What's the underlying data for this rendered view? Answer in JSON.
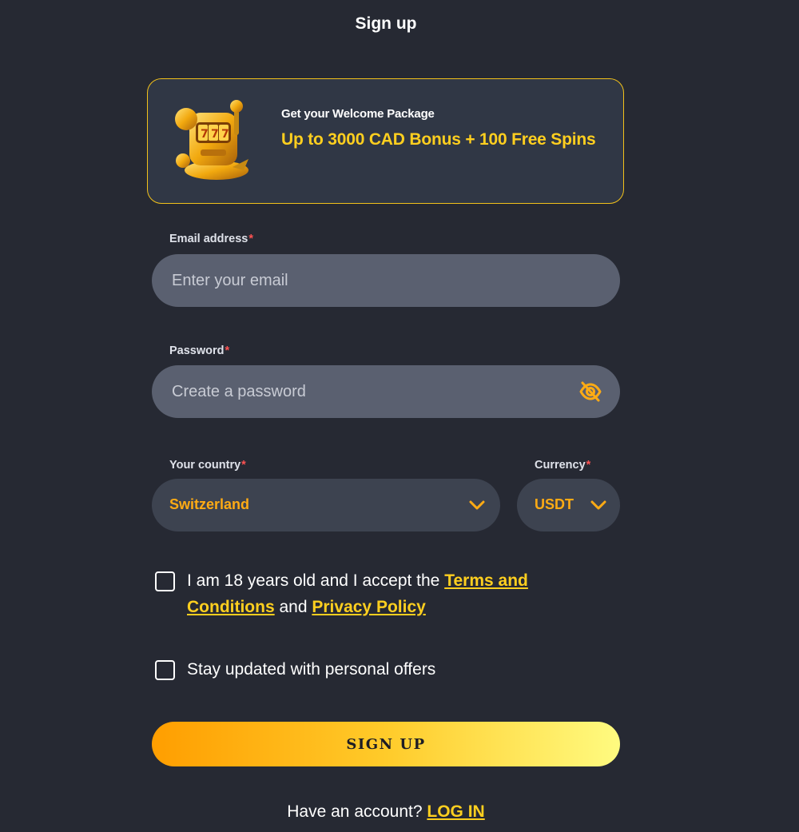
{
  "header": {
    "title": "Sign up"
  },
  "promo": {
    "subtitle": "Get your Welcome Package",
    "headline": "Up to 3000 CAD Bonus + 100 Free Spins",
    "art_icon": "slot-machine-icon"
  },
  "form": {
    "email": {
      "label": "Email address",
      "required_mark": "*",
      "placeholder": "Enter your email",
      "value": ""
    },
    "password": {
      "label": "Password",
      "required_mark": "*",
      "placeholder": "Create a password",
      "value": "",
      "toggle_icon": "eye-off-icon"
    },
    "country": {
      "label": "Your country",
      "required_mark": "*",
      "value": "Switzerland"
    },
    "currency": {
      "label": "Currency",
      "required_mark": "*",
      "value": "USDT"
    }
  },
  "consent": {
    "age": {
      "text_before": "I am 18 years old and I accept the ",
      "terms_link": "Terms and Conditions",
      "text_middle": " and ",
      "privacy_link": "Privacy Policy",
      "checked": false
    },
    "offers": {
      "text": "Stay updated with personal offers",
      "checked": false
    }
  },
  "actions": {
    "signup_label": "SIGN UP"
  },
  "footer": {
    "prompt": "Have an account? ",
    "login_link": "LOG IN"
  },
  "colors": {
    "background": "#262933",
    "accent": "#ffcf1f",
    "orange": "#ffab14",
    "required": "#ff5252",
    "promo_border": "#f2c11a"
  }
}
